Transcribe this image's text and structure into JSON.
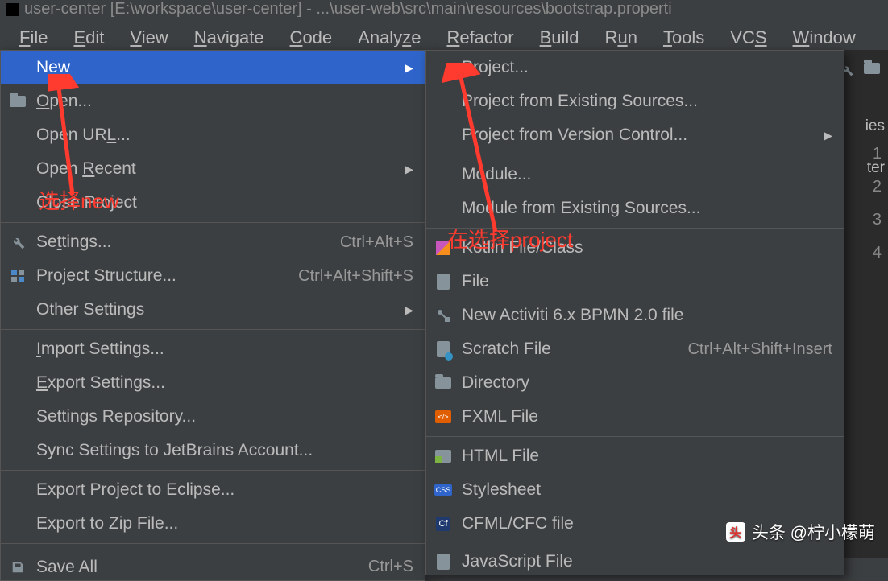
{
  "title": "user-center [E:\\workspace\\user-center] - ...\\user-web\\src\\main\\resources\\bootstrap.properti",
  "menu_bar": [
    "File",
    "Edit",
    "View",
    "Navigate",
    "Code",
    "Analyze",
    "Refactor",
    "Build",
    "Run",
    "Tools",
    "VCS",
    "Window"
  ],
  "file_menu": {
    "new": "New",
    "open": "Open...",
    "open_url": "Open URL...",
    "open_recent": "Open Recent",
    "close_project": "Close Project",
    "settings": "Settings...",
    "settings_sc": "Ctrl+Alt+S",
    "project_structure": "Project Structure...",
    "project_structure_sc": "Ctrl+Alt+Shift+S",
    "other_settings": "Other Settings",
    "import_settings": "Import Settings...",
    "export_settings": "Export Settings...",
    "settings_repo": "Settings Repository...",
    "sync_settings": "Sync Settings to JetBrains Account...",
    "export_eclipse": "Export Project to Eclipse...",
    "export_zip": "Export to Zip File...",
    "save_all": "Save All",
    "save_all_sc": "Ctrl+S"
  },
  "new_menu": {
    "project": "Project...",
    "proj_existing": "Project from Existing Sources...",
    "proj_vcs": "Project from Version Control...",
    "module": "Module...",
    "module_existing": "Module from Existing Sources...",
    "kotlin": "Kotlin File/Class",
    "file": "File",
    "activiti": "New Activiti 6.x BPMN 2.0 file",
    "scratch": "Scratch File",
    "scratch_sc": "Ctrl+Alt+Shift+Insert",
    "directory": "Directory",
    "fxml": "FXML File",
    "html": "HTML File",
    "stylesheet": "Stylesheet",
    "cfml": "CFML/CFC file",
    "js": "JavaScript File"
  },
  "annotations": {
    "a1": "选择new",
    "a2": "在选择project"
  },
  "watermark": "头条 @柠小檬萌",
  "bg": {
    "ies": "ies",
    "ter": "ter",
    "lines": [
      "1",
      "2",
      "3",
      "4"
    ]
  }
}
